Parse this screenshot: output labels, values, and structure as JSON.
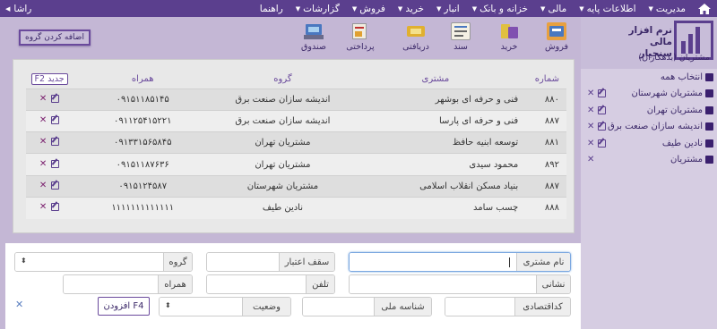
{
  "topbar": {
    "home_icon": "home-icon",
    "menus": [
      {
        "label": "مدیریت"
      },
      {
        "label": "اطلاعات پایه"
      },
      {
        "label": "مالی"
      },
      {
        "label": "خزانه و بانک"
      },
      {
        "label": "انبار"
      },
      {
        "label": "خرید"
      },
      {
        "label": "فروش"
      },
      {
        "label": "گزارشات"
      }
    ],
    "help_label": "راهنما",
    "user_label": "راشا"
  },
  "brand": {
    "title": "نرم افزار مالی سنجیار",
    "subtitle": "مشتریان (بدهکاران)"
  },
  "groups": {
    "select_all_label": "انتخاب همه",
    "items": [
      {
        "label": "مشتریان شهرستان"
      },
      {
        "label": "مشتریان تهران"
      },
      {
        "label": "اندیشه سازان صنعت برق"
      },
      {
        "label": "نادین طیف"
      },
      {
        "label": "مشتریان"
      }
    ]
  },
  "toolbar": {
    "add_group_label": "اضافه کردن گروه",
    "tools": [
      {
        "label": "فروش",
        "icon": "sale-icon"
      },
      {
        "label": "خرید",
        "icon": "purchase-icon"
      },
      {
        "label": "سند",
        "icon": "document-icon"
      },
      {
        "label": "دریافتی",
        "icon": "receipt-icon"
      },
      {
        "label": "پرداختی",
        "icon": "payment-icon"
      },
      {
        "label": "صندوق",
        "icon": "cashbox-icon"
      }
    ]
  },
  "table": {
    "headers": {
      "number": "شماره",
      "customer": "مشتری",
      "group": "گروه",
      "mobile": "همراه",
      "new": "جدید F2"
    },
    "rows": [
      {
        "number": "۸۸۰",
        "customer": "فنی و حرفه ای بوشهر",
        "group": "اندیشه سازان صنعت برق",
        "mobile": "۰۹۱۵۱۱۸۵۱۴۵"
      },
      {
        "number": "۸۸۷",
        "customer": "فنی و حرفه ای پارسا",
        "group": "اندیشه سازان صنعت برق",
        "mobile": "۰۹۱۱۲۵۴۱۵۲۲۱"
      },
      {
        "number": "۸۸۱",
        "customer": "توسعه ابنیه حافظ",
        "group": "مشتریان تهران",
        "mobile": "۰۹۱۳۳۱۵۶۵۸۴۵"
      },
      {
        "number": "۸۹۲",
        "customer": "محمود سیدی",
        "group": "مشتریان تهران",
        "mobile": "۰۹۱۵۱۱۸۷۶۳۶"
      },
      {
        "number": "۸۸۷",
        "customer": "بنیاد مسکن انقلاب اسلامی",
        "group": "مشتریان شهرستان",
        "mobile": "۰۹۱۵۱۲۴۵۸۷"
      },
      {
        "number": "۸۸۸",
        "customer": "چسب سامد",
        "group": "نادین طیف",
        "mobile": "۱۱۱۱۱۱۱۱۱۱۱۱۱"
      }
    ]
  },
  "form": {
    "customer_name_label": "نام مشتری",
    "customer_name_value": "",
    "credit_limit_label": "سقف اعتبار",
    "group_label": "گروه",
    "address_label": "نشانی",
    "phone_label": "تلفن",
    "mobile_label": "همراه",
    "economic_code_label": "کداقتصادی",
    "national_id_label": "شناسه ملی",
    "status_label": "وضعیت",
    "add_button_label": "افزودن F4"
  }
}
